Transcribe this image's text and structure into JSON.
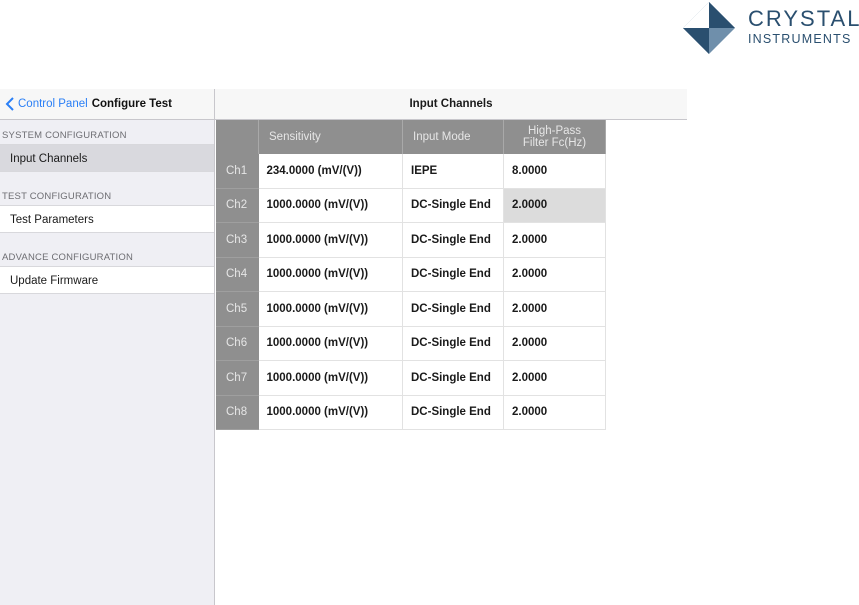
{
  "brand": {
    "line1": "CRYSTAL",
    "line2": "INSTRUMENTS",
    "colors": {
      "dark": "#2a4f6f",
      "light": "#6f8fab"
    }
  },
  "sidebar": {
    "back_label": "Control Panel",
    "title": "Configure Test",
    "sections": [
      {
        "label": "SYSTEM CONFIGURATION",
        "items": [
          {
            "label": "Input Channels",
            "active": true
          }
        ]
      },
      {
        "label": "TEST CONFIGURATION",
        "items": [
          {
            "label": "Test Parameters",
            "active": false
          }
        ]
      },
      {
        "label": "ADVANCE CONFIGURATION",
        "items": [
          {
            "label": "Update Firmware",
            "active": false
          }
        ]
      }
    ]
  },
  "main": {
    "title": "Input Channels",
    "columns": {
      "sensitivity": "Sensitivity",
      "input_mode": "Input Mode",
      "hpf_line1": "High-Pass",
      "hpf_line2": "Filter Fc(Hz)"
    },
    "rows": [
      {
        "ch": "Ch1",
        "sensitivity": "234.0000 (mV/(V))",
        "mode": "IEPE",
        "hpf": "8.0000"
      },
      {
        "ch": "Ch2",
        "sensitivity": "1000.0000 (mV/(V))",
        "mode": "DC-Single End",
        "hpf": "2.0000"
      },
      {
        "ch": "Ch3",
        "sensitivity": "1000.0000 (mV/(V))",
        "mode": "DC-Single End",
        "hpf": "2.0000"
      },
      {
        "ch": "Ch4",
        "sensitivity": "1000.0000 (mV/(V))",
        "mode": "DC-Single End",
        "hpf": "2.0000"
      },
      {
        "ch": "Ch5",
        "sensitivity": "1000.0000 (mV/(V))",
        "mode": "DC-Single End",
        "hpf": "2.0000"
      },
      {
        "ch": "Ch6",
        "sensitivity": "1000.0000 (mV/(V))",
        "mode": "DC-Single End",
        "hpf": "2.0000"
      },
      {
        "ch": "Ch7",
        "sensitivity": "1000.0000 (mV/(V))",
        "mode": "DC-Single End",
        "hpf": "2.0000"
      },
      {
        "ch": "Ch8",
        "sensitivity": "1000.0000 (mV/(V))",
        "mode": "DC-Single End",
        "hpf": "2.0000"
      }
    ],
    "selected_cell": {
      "row": 1,
      "column": "hpf"
    }
  },
  "colors": {
    "accent": "#2a7ff6",
    "header_gray": "#8f8f8f",
    "selected": "#dcdcdc"
  },
  "icons": {
    "back": "chevron-left-icon",
    "logo": "crystal-diamond-icon"
  }
}
